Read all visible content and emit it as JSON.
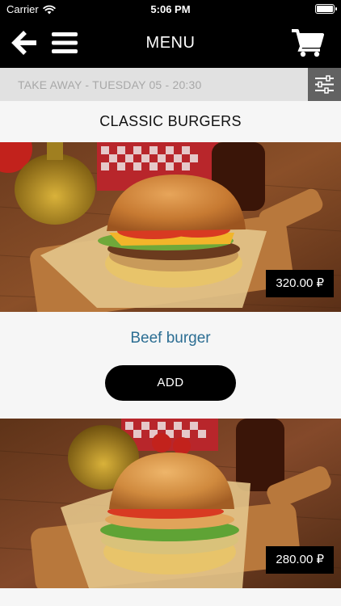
{
  "status_bar": {
    "carrier": "Carrier",
    "time": "5:06 PM"
  },
  "header": {
    "title": "MENU",
    "back_icon": "arrow-left-icon",
    "menu_icon": "hamburger-menu-icon",
    "cart_icon": "cart-icon"
  },
  "delivery_bar": {
    "text": "TAKE AWAY - TUESDAY 05 - 20:30",
    "filter_icon": "sliders-icon"
  },
  "category": {
    "title": "CLASSIC BURGERS"
  },
  "products": [
    {
      "name": "Beef burger",
      "price": "320.00 ₽",
      "add_label": "ADD"
    },
    {
      "name": "",
      "price": "280.00 ₽",
      "add_label": ""
    }
  ],
  "colors": {
    "nav_background": "#000000",
    "product_name": "#2c6e93",
    "info_text": "#a8a8a8",
    "filter_button": "#626262"
  }
}
